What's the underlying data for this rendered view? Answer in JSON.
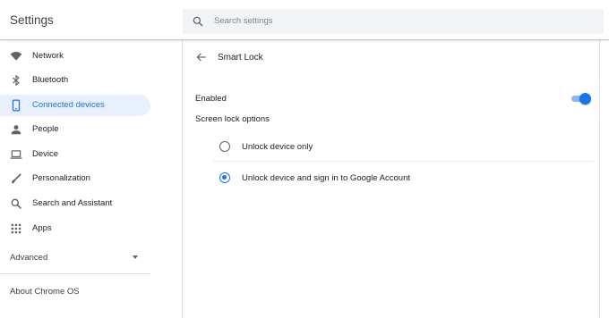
{
  "app": {
    "title": "Settings"
  },
  "search": {
    "placeholder": "Search settings",
    "icon": "search-icon"
  },
  "sidebar": {
    "items": [
      {
        "label": "Network",
        "icon": "wifi-icon",
        "active": false
      },
      {
        "label": "Bluetooth",
        "icon": "bluetooth-icon",
        "active": false
      },
      {
        "label": "Connected devices",
        "icon": "phone-icon",
        "active": true
      },
      {
        "label": "People",
        "icon": "person-icon",
        "active": false
      },
      {
        "label": "Device",
        "icon": "laptop-icon",
        "active": false
      },
      {
        "label": "Personalization",
        "icon": "brush-icon",
        "active": false
      },
      {
        "label": "Search and Assistant",
        "icon": "search-icon",
        "active": false
      },
      {
        "label": "Apps",
        "icon": "apps-grid-icon",
        "active": false
      }
    ],
    "advanced_label": "Advanced",
    "about_label": "About Chrome OS"
  },
  "main": {
    "title": "Smart Lock",
    "enabled_label": "Enabled",
    "enabled": true,
    "screen_lock_label": "Screen lock options",
    "options": [
      {
        "label": "Unlock device only",
        "selected": false
      },
      {
        "label": "Unlock device and sign in to Google Account",
        "selected": true
      }
    ]
  },
  "colors": {
    "accent": "#1a73e8",
    "accent_light": "#8ab4f8",
    "active_bg": "#e8f0fe"
  }
}
